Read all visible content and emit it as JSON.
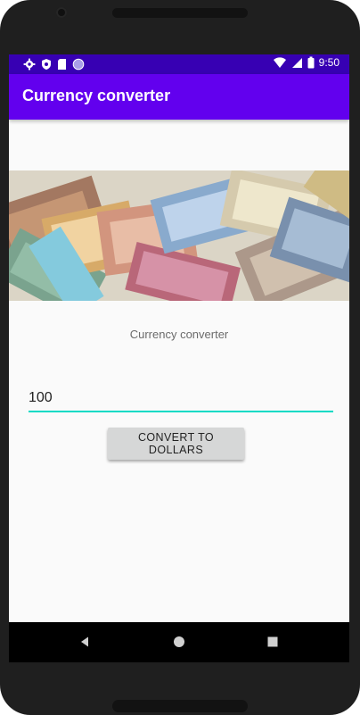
{
  "status_bar": {
    "time": "9:50",
    "left_icons": [
      "gear-icon",
      "shield-icon",
      "sd-card-icon",
      "circle-icon"
    ],
    "right_icons": [
      "wifi-icon",
      "signal-icon",
      "battery-icon"
    ]
  },
  "app_bar": {
    "title": "Currency converter"
  },
  "main": {
    "caption": "Currency converter",
    "amount_value": "100",
    "convert_label": "CONVERT TO DOLLARS"
  },
  "nav_bar": {
    "buttons": [
      "back-icon",
      "home-icon",
      "recents-icon"
    ]
  },
  "colors": {
    "status_bar": "#3700b3",
    "app_bar": "#6200ee",
    "accent": "#03dac5",
    "button_bg": "#d6d7d7"
  }
}
